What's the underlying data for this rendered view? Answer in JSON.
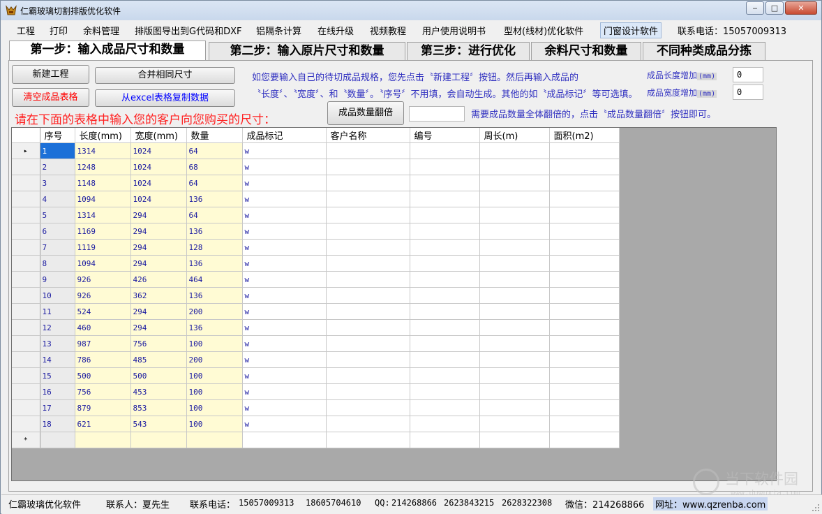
{
  "window": {
    "title": "仁霸玻璃切割排版优化软件",
    "minimize": "‒",
    "maximize": "□",
    "close": "✕"
  },
  "menu": [
    "工程",
    "打印",
    "余料管理",
    "排版图导出到G代码和DXF",
    "铝隔条计算",
    "在线升级",
    "视频教程",
    "用户使用说明书",
    "型材(线材)优化软件",
    "门窗设计软件",
    "联系电话：15057009313"
  ],
  "tabs": [
    "第一步：输入成品尺寸和数量",
    "第二步：输入原片尺寸和数量",
    "第三步：进行优化",
    "余料尺寸和数量",
    "不同种类成品分拣"
  ],
  "buttons": {
    "new_project": "新建工程",
    "merge_sizes": "合并相同尺寸",
    "clear_table": "清空成品表格",
    "copy_excel": "从excel表格复制数据",
    "double_qty": "成品数量翻倍"
  },
  "hints": {
    "line1": "如您要输入自己的待切成品规格，您先点击〝新建工程〞按钮。然后再输入成品的",
    "line2": "〝长度〞、〝宽度〞、和〝数量〞。〝序号〞不用填，会自动生成。其他的如〝成品标记〞等可选填。",
    "red": "请在下面的表格中输入您的客户向您购买的尺寸：",
    "double_hint": "需要成品数量全体翻倍的，点击〝成品数量翻倍〞按钮即可。"
  },
  "fields": {
    "length_add_label": "成品长度增加",
    "width_add_label": "成品宽度增加",
    "unit": "(mm)",
    "length_add_value": "0",
    "width_add_value": "0",
    "double_value": ""
  },
  "table": {
    "columns": [
      "序号",
      "长度(mm)",
      "宽度(mm)",
      "数量",
      "成品标记",
      "客户名称",
      "编号",
      "周长(m)",
      "面积(m2)"
    ],
    "rows": [
      [
        "1",
        "1314",
        "1024",
        "64",
        "w"
      ],
      [
        "2",
        "1248",
        "1024",
        "68",
        "w"
      ],
      [
        "3",
        "1148",
        "1024",
        "64",
        "w"
      ],
      [
        "4",
        "1094",
        "1024",
        "136",
        "w"
      ],
      [
        "5",
        "1314",
        "294",
        "64",
        "w"
      ],
      [
        "6",
        "1169",
        "294",
        "136",
        "w"
      ],
      [
        "7",
        "1119",
        "294",
        "128",
        "w"
      ],
      [
        "8",
        "1094",
        "294",
        "136",
        "w"
      ],
      [
        "9",
        "926",
        "426",
        "464",
        "w"
      ],
      [
        "10",
        "926",
        "362",
        "136",
        "w"
      ],
      [
        "11",
        "524",
        "294",
        "200",
        "w"
      ],
      [
        "12",
        "460",
        "294",
        "136",
        "w"
      ],
      [
        "13",
        "987",
        "756",
        "100",
        "w"
      ],
      [
        "14",
        "786",
        "485",
        "200",
        "w"
      ],
      [
        "15",
        "500",
        "500",
        "100",
        "w"
      ],
      [
        "16",
        "756",
        "453",
        "100",
        "w"
      ],
      [
        "17",
        "879",
        "853",
        "100",
        "w"
      ],
      [
        "18",
        "621",
        "543",
        "100",
        "w"
      ]
    ],
    "current_row_marker": "▸",
    "new_row_marker": "*"
  },
  "status": {
    "app": "仁霸玻璃优化软件",
    "contact": "联系人：夏先生",
    "phone_label": "联系电话：",
    "phone1": "15057009313",
    "phone2": "18605704610",
    "qq_label": "QQ:",
    "qq1": "214268866",
    "qq2": "2623843215",
    "qq3": "2628322308",
    "wechat": "微信：214268866",
    "site": "网址：www.qzrenba.com"
  },
  "watermark": {
    "name": "当下软件园",
    "url": "www.downxia.com"
  }
}
